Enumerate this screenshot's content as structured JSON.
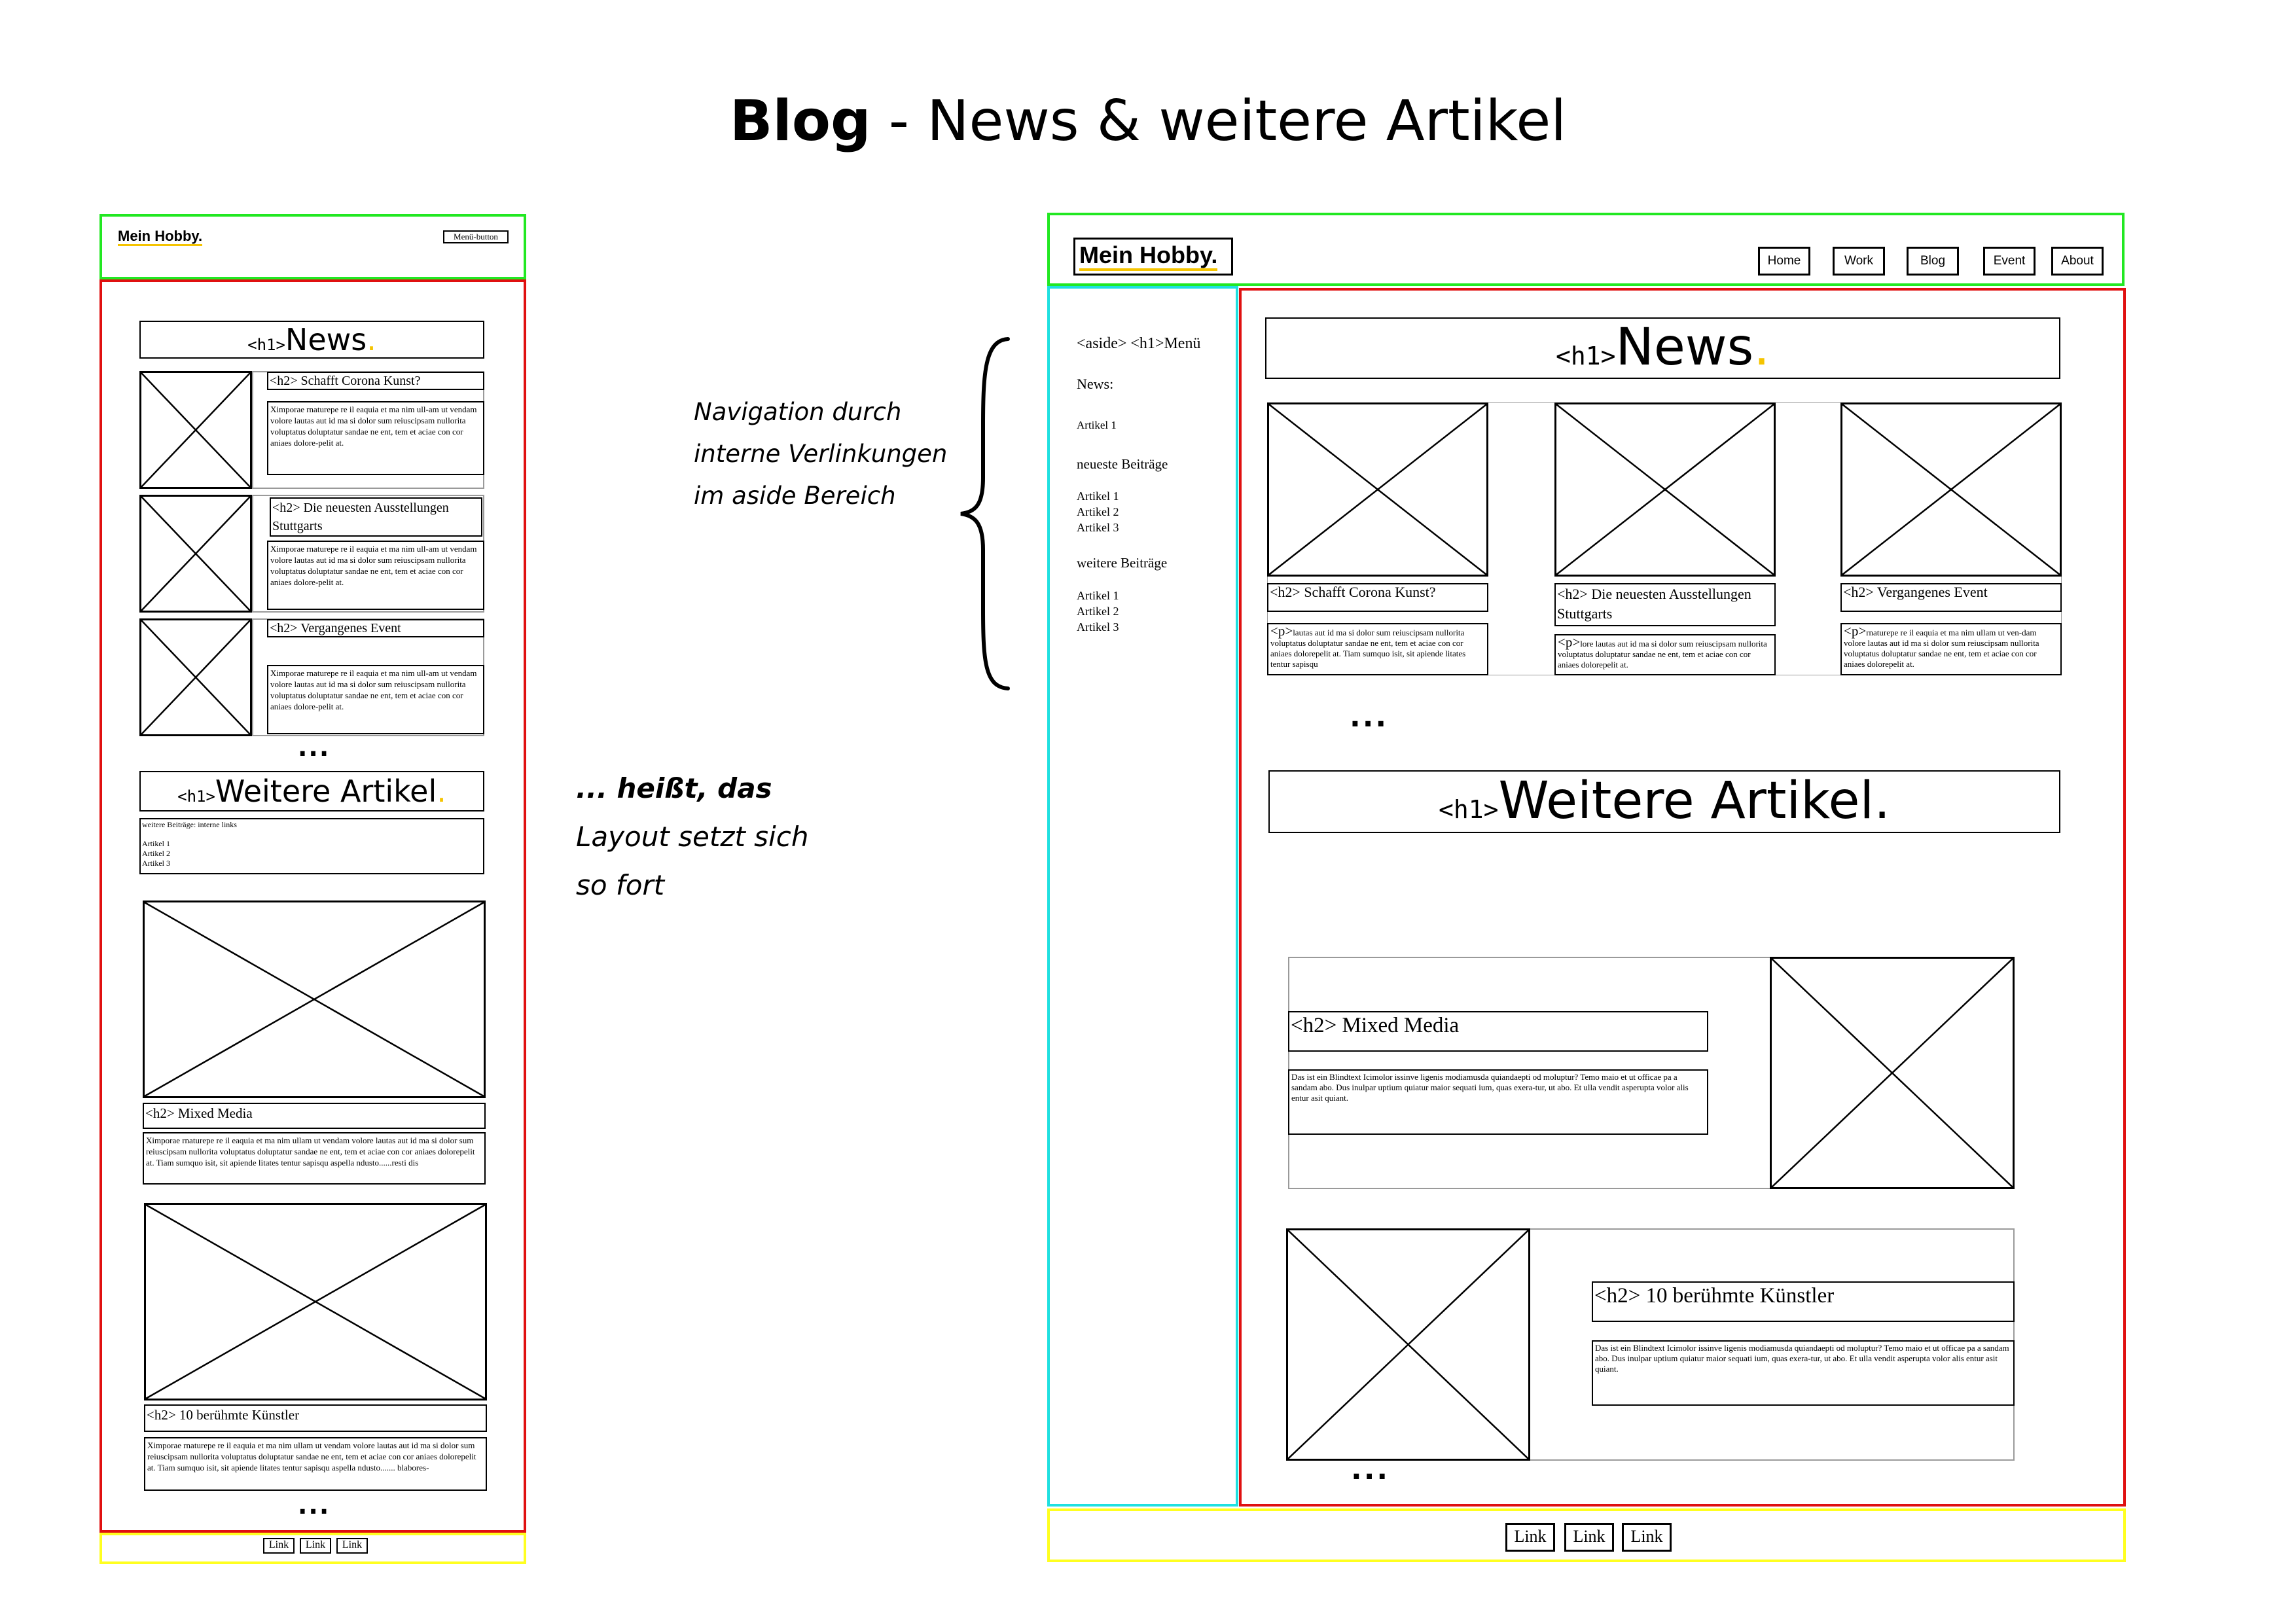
{
  "title": {
    "bold": "Blog",
    "rest": " - News & weitere Artikel"
  },
  "brand_color": "#f5c400",
  "region_colors": {
    "header": "#22e822",
    "main": "#e01010",
    "aside": "#20e0e0",
    "footer": "#ffff20"
  },
  "mobile": {
    "logo": "Mein Hobby.",
    "menu_button": "Menü-button",
    "news_h1_tag": "<h1>",
    "news_h1": "News",
    "news_dot": ".",
    "articles": [
      {
        "h2": "<h2> Schafft Corona Kunst?",
        "text": "Ximporae rnaturepe re il eaquia et ma nim ull-am ut vendam volore lautas aut id ma si dolor sum reiuscipsam nullorita voluptatus doluptatur sandae ne ent, tem et aciae con cor aniaes dolore-pelit at."
      },
      {
        "h2": "<h2> Die neuesten Ausstellungen Stuttgarts",
        "text": "Ximporae rnaturepe re il eaquia et ma nim ull-am ut vendam volore lautas aut id ma si dolor sum reiuscipsam nullorita voluptatus doluptatur sandae ne ent, tem et aciae con cor aniaes dolore-pelit at."
      },
      {
        "h2": "<h2> Vergangenes Event",
        "text": "Ximporae rnaturepe re il eaquia et ma nim ull-am ut vendam volore lautas aut id ma si dolor sum reiuscipsam nullorita voluptatus doluptatur sandae ne ent, tem et aciae con cor aniaes dolore-pelit at."
      }
    ],
    "ellipsis": "...",
    "more_h1_tag": "<h1>",
    "more_h1": "Weitere Artikel",
    "more_dot": ".",
    "links_title": "weitere Beiträge: interne links",
    "links": [
      "Artikel 1",
      "Artikel 2",
      "Artikel 3"
    ],
    "big_articles": [
      {
        "h2": "<h2> Mixed Media",
        "text": "Ximporae rnaturepe re il eaquia et ma nim ullam ut vendam volore lautas aut id ma si dolor sum reiuscipsam nullorita voluptatus doluptatur sandae ne ent, tem et aciae con cor aniaes dolorepelit at. Tiam sumquo isit, sit apiende litates tentur sapisqu aspella ndusto......resti dis"
      },
      {
        "h2": "<h2> 10 berühmte Künstler",
        "text": "Ximporae rnaturepe re il eaquia et ma nim ullam ut vendam volore lautas aut id ma si dolor sum reiuscipsam nullorita voluptatus doluptatur sandae ne ent, tem et aciae con cor aniaes dolorepelit at. Tiam sumquo isit, sit apiende litates tentur sapisqu aspella ndusto....... blabores-"
      }
    ],
    "ellipsis2": "...",
    "footer_links": [
      "Link",
      "Link",
      "Link"
    ]
  },
  "annotations": {
    "nav_note": [
      "Navigation durch",
      "interne Verlinkungen",
      "im aside Bereich"
    ],
    "dots_note": [
      "... heißt, das",
      "Layout setzt sich",
      "so fort"
    ]
  },
  "desktop": {
    "logo": "Mein Hobby.",
    "nav": [
      "Home",
      "Work",
      "Blog",
      "Event",
      "About"
    ],
    "aside": {
      "heading": "<aside> <h1>Menü",
      "news_label": "News:",
      "news_item": "Artikel 1",
      "newest_label": "neueste Beiträge",
      "newest_items": [
        "Artikel 1",
        "Artikel 2",
        "Artikel 3"
      ],
      "more_label": "weitere Beiträge",
      "more_items": [
        "Artikel 1",
        "Artikel 2",
        "Artikel 3"
      ]
    },
    "news_h1_tag": "<h1>",
    "news_h1": "News",
    "news_dot": ".",
    "cards": [
      {
        "h2": "<h2> Schafft Corona Kunst?",
        "p_tag": "<p>",
        "text": "lautas aut id ma si dolor sum reiuscipsam nullorita voluptatus doluptatur sandae ne ent, tem et aciae con cor aniaes dolorepelit at. Tiam sumquo isit, sit apiende litates tentur sapisqu"
      },
      {
        "h2": "<h2> Die neuesten Ausstellungen Stuttgarts",
        "p_tag": "<p>",
        "text": "lore lautas aut id ma si dolor sum reiuscipsam nullorita voluptatus doluptatur sandae ne ent, tem et aciae con cor aniaes dolorepelit at."
      },
      {
        "h2": "<h2> Vergangenes Event",
        "p_tag": "<p>",
        "text": "rnaturepe re il eaquia et ma nim ullam ut ven-dam volore lautas aut id ma si dolor sum reiuscipsam nullorita voluptatus doluptatur sandae ne ent, tem et aciae con cor aniaes dolorepelit at."
      }
    ],
    "ellipsis": "...",
    "more_h1_tag": "<h1>",
    "more_h1": "Weitere Artikel",
    "more_dot": ".",
    "big_articles": [
      {
        "h2": "<h2> Mixed Media",
        "text": "Das ist ein Blindtext Icimolor issinve ligenis modiamusda quiandaepti od moluptur? Temo maio et ut officae pa a sandam abo. Dus inulpar uptium quiatur maior sequati ium, quas exera-tur, ut abo. Et ulla vendit asperupta volor alis entur asit quiant."
      },
      {
        "h2": "<h2> 10 berühmte Künstler",
        "text": "Das ist ein Blindtext Icimolor issinve ligenis modiamusda quiandaepti od moluptur? Temo maio et ut officae pa a sandam abo. Dus inulpar uptium quiatur maior sequati ium, quas exera-tur, ut abo. Et ulla vendit asperupta volor alis entur asit quiant."
      }
    ],
    "ellipsis2": "...",
    "footer_links": [
      "Link",
      "Link",
      "Link"
    ]
  }
}
